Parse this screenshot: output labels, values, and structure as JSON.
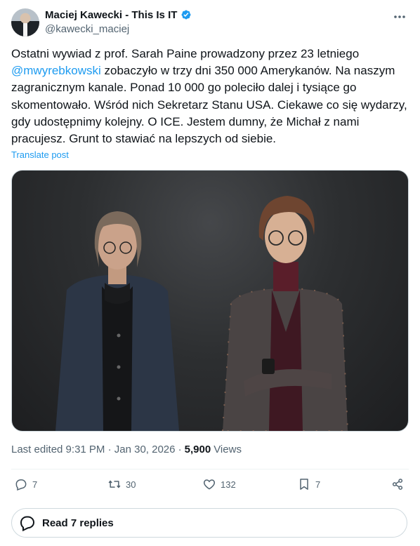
{
  "author": {
    "display_name": "Maciej Kawecki - This Is IT",
    "handle": "@kawecki_maciej",
    "verified": true
  },
  "tweet": {
    "text_part1": "Ostatni wywiad z prof. Sarah Paine prowadzony przez 23 letniego\n",
    "mention": "@mwyrebkowski",
    "text_part2": " zobaczyło w trzy dni 350 000 Amerykanów. Na naszym zagranicznym kanale. Ponad 10 000 go poleciło dalej i tysiące go skomentowało. Wśród nich Sekretarz Stanu USA. Ciekawe co się wydarzy, gdy udostępnimy kolejny. O ICE. Jestem dumny, że Michał z nami pracujesz. Grunt to stawiać na lepszych od siebie.",
    "translate_label": "Translate post"
  },
  "meta": {
    "edited_label": "Last edited 9:31 PM · Jan 30, 2026 ·",
    "views_count": "5,900",
    "views_label": "Views"
  },
  "actions": {
    "replies": "7",
    "reposts": "30",
    "likes": "132",
    "bookmarks": "7"
  },
  "read_replies_label": "Read 7 replies",
  "colors": {
    "accent": "#1d9bf0",
    "text": "#0f1419",
    "secondary": "#536471",
    "border": "#cfd9de"
  }
}
